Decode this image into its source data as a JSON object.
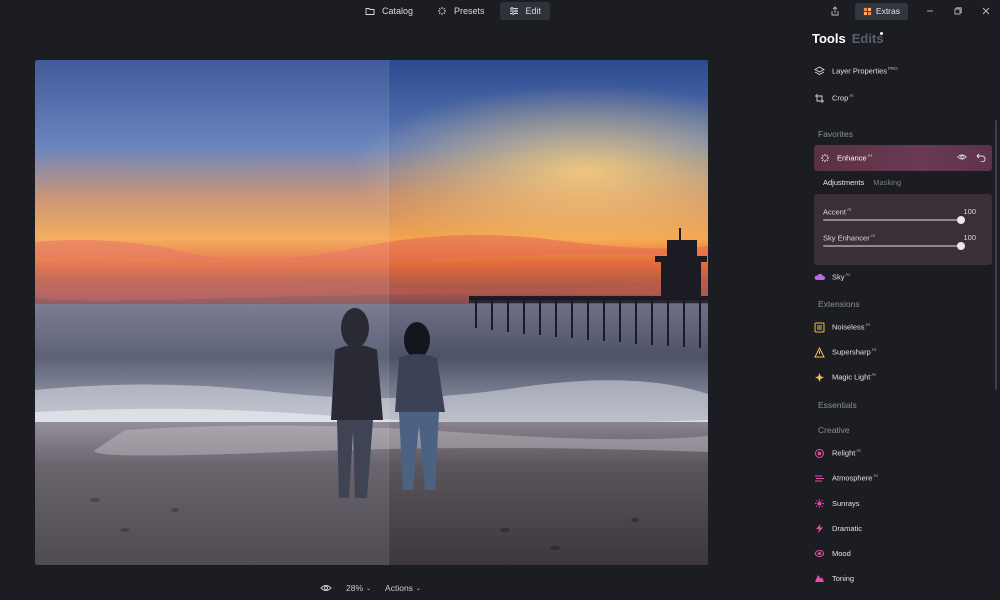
{
  "top_tabs": [
    {
      "label": "Catalog",
      "icon": "folder-icon"
    },
    {
      "label": "Presets",
      "icon": "sparkle-icon"
    },
    {
      "label": "Edit",
      "icon": "sliders-icon",
      "active": true
    }
  ],
  "extras_label": "Extras",
  "panel": {
    "tab_tools": "Tools",
    "tab_edits": "Edits",
    "layer_properties": {
      "label": "Layer Properties",
      "badge": "PRO"
    },
    "crop": {
      "label": "Crop",
      "badge": "AI"
    },
    "section_favorites": "Favorites",
    "enhance": {
      "label": "Enhance",
      "badge": "AI"
    },
    "subtab_adjustments": "Adjustments",
    "subtab_masking": "Masking",
    "sliders": [
      {
        "label": "Accent",
        "badge": "AI",
        "value": "100",
        "level": 1.0
      },
      {
        "label": "Sky Enhancer",
        "badge": "AI",
        "value": "100",
        "level": 1.0
      }
    ],
    "sky": {
      "label": "Sky",
      "badge": "AI"
    },
    "section_extensions": "Extensions",
    "noiseless": {
      "label": "Noiseless",
      "badge": "AI"
    },
    "supersharp": {
      "label": "Supersharp",
      "badge": "AI"
    },
    "magic_light": {
      "label": "Magic Light",
      "badge": "AI"
    },
    "section_essentials": "Essentials",
    "section_creative": "Creative",
    "relight": {
      "label": "Relight",
      "badge": "AI"
    },
    "atmosphere": {
      "label": "Atmosphere",
      "badge": "AI"
    },
    "sunrays": {
      "label": "Sunrays"
    },
    "dramatic": {
      "label": "Dramatic"
    },
    "mood": {
      "label": "Mood"
    },
    "toning": {
      "label": "Toning"
    }
  },
  "bottom": {
    "zoom": "28%",
    "actions": "Actions"
  },
  "colors": {
    "accent_enhance": "#6a3a52",
    "panel_bg": "#1b1d22"
  }
}
